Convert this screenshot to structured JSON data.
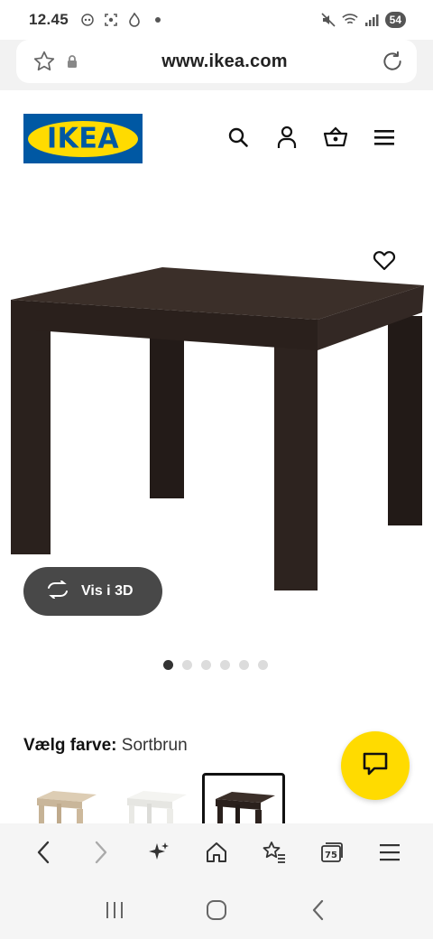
{
  "status_bar": {
    "time": "12.45",
    "battery": "54"
  },
  "browser": {
    "url": "www.ikea.com"
  },
  "header": {
    "logo_text": "IKEA",
    "icons": [
      "search-icon",
      "user-icon",
      "basket-icon",
      "menu-icon"
    ]
  },
  "product": {
    "view_3d_label": "Vis i 3D",
    "image_count": 6,
    "active_image": 1,
    "color_label": "Vælg farve:",
    "color_value": "Sortbrun",
    "swatches": [
      "White stained oak effect",
      "White",
      "Black-brown"
    ]
  },
  "colors": {
    "ikea_blue": "#0058a3",
    "ikea_yellow": "#ffdb00",
    "table_brown": "#2e2420"
  }
}
